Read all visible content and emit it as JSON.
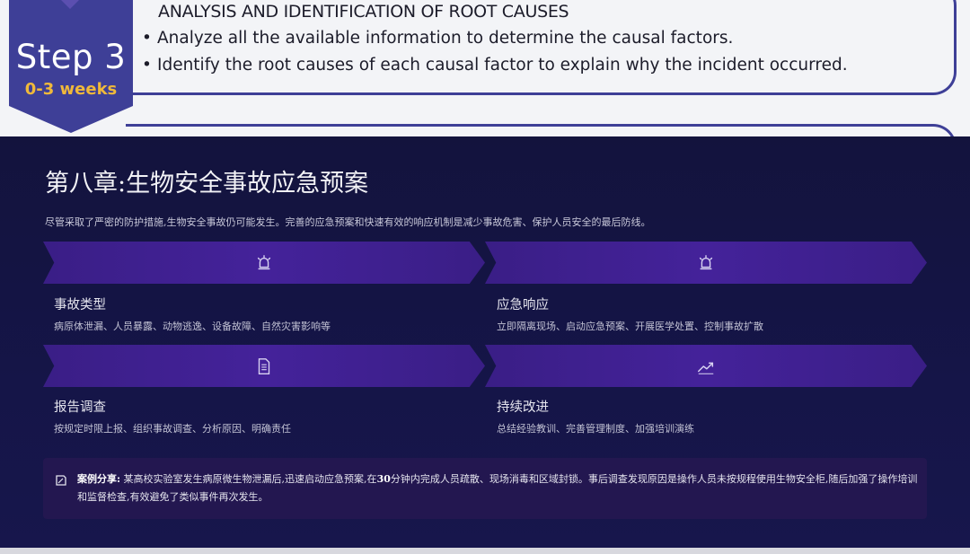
{
  "step_panel": {
    "step_label": "Step 3",
    "duration": "0-3 weeks",
    "heading": "ANALYSIS AND IDENTIFICATION OF ROOT CAUSES",
    "bullets": [
      "Analyze all the available information to determine the causal factors.",
      "Identify the root causes of each causal factor to explain why the incident occurred."
    ]
  },
  "chapter": {
    "title": "第八章:生物安全事故应急预案",
    "intro": "尽管采取了严密的防护措施,生物安全事故仍可能发生。完善的应急预案和快速有效的响应机制是减少事故危害、保护人员安全的最后防线。"
  },
  "cards": [
    {
      "icon": "siren-icon",
      "title": "事故类型",
      "desc": "病原体泄漏、人员暴露、动物逃逸、设备故障、自然灾害影响等"
    },
    {
      "icon": "siren-icon",
      "title": "应急响应",
      "desc": "立即隔离现场、启动应急预案、开展医学处置、控制事故扩散"
    },
    {
      "icon": "document-icon",
      "title": "报告调查",
      "desc": "按规定时限上报、组织事故调查、分析原因、明确责任"
    },
    {
      "icon": "trend-up-icon",
      "title": "持续改进",
      "desc": "总结经验教训、完善管理制度、加强培训演练"
    }
  ],
  "case": {
    "icon": "note-icon",
    "label": "案例分享:",
    "text_before": " 某高校实验室发生病原微生物泄漏后,迅速启动应急预案,在",
    "highlight": "30",
    "text_after": "分钟内完成人员疏散、现场消毒和区域封锁。事后调查发现原因是操作人员未按规程使用生物安全柜,随后加强了操作培训和监督检查,有效避免了类似事件再次发生。"
  },
  "colors": {
    "background": "#11123a",
    "banner": "#44229a",
    "step_badge": "#3e3f97",
    "step_duration": "#f0b93a",
    "case_box": "#231750"
  }
}
